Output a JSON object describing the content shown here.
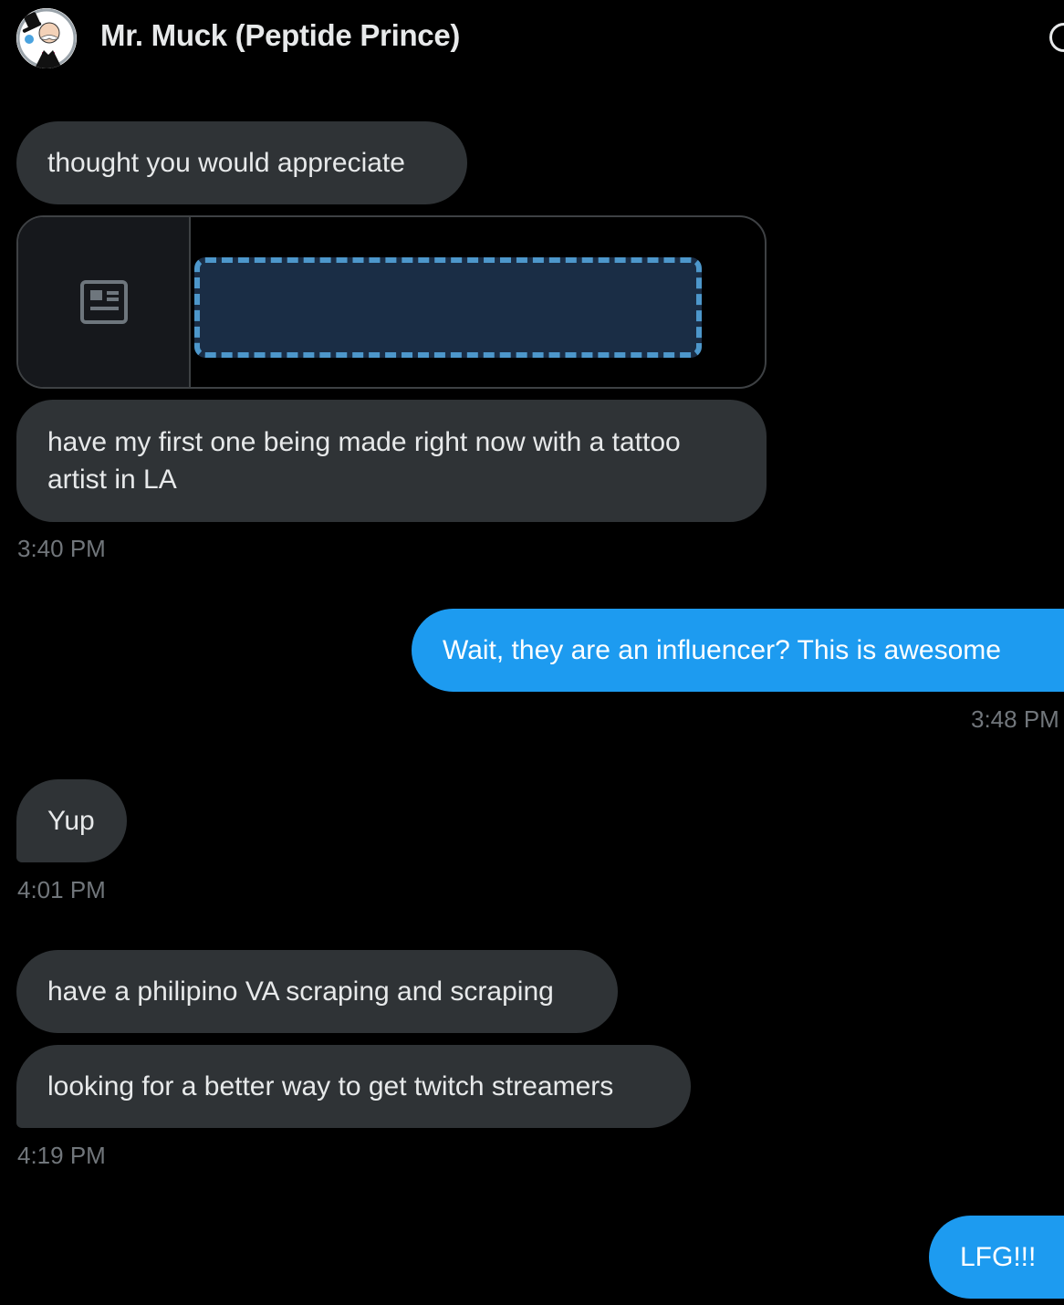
{
  "header": {
    "contact_name": "Mr. Muck (Peptide Prince)",
    "avatar_icon": "monopoly-man-avatar-icon",
    "info_icon": "info-icon"
  },
  "messages": [
    {
      "direction": "incoming",
      "text": "thought you would appreciate"
    },
    {
      "direction": "incoming",
      "type": "link-card",
      "icon": "article-icon",
      "title": ""
    },
    {
      "direction": "incoming",
      "text_line1": "have my first one being made right now with a tattoo",
      "text_line2": "artist in LA"
    },
    {
      "direction": "outgoing",
      "text": "Wait, they are an influencer? This is awesome"
    },
    {
      "direction": "incoming",
      "text": "Yup"
    },
    {
      "direction": "incoming",
      "text": "have a philipino VA scraping and scraping"
    },
    {
      "direction": "incoming",
      "text": "looking for a better way to get twitch streamers"
    },
    {
      "direction": "outgoing",
      "text": "LFG!!!"
    }
  ],
  "timestamps": {
    "t1": "3:40 PM",
    "t2": "3:48 PM",
    "t3": "4:01 PM",
    "t4": "4:19 PM"
  },
  "colors": {
    "background": "#000000",
    "incoming_bubble": "#2f3336",
    "outgoing_bubble": "#1d9bf0",
    "timestamp": "#71767b",
    "redaction_fill": "#1a2d45",
    "redaction_border": "#4d97cb"
  }
}
